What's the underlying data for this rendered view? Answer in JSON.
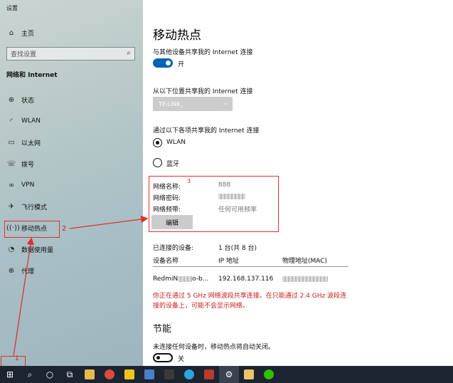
{
  "window": {
    "title": "设置"
  },
  "sidebar": {
    "home": "主页",
    "search_placeholder": "查找设置",
    "section": "网络和 Internet",
    "items": [
      {
        "label": "状态",
        "icon": "globe-icon"
      },
      {
        "label": "WLAN",
        "icon": "wifi-icon"
      },
      {
        "label": "以太网",
        "icon": "ethernet-icon"
      },
      {
        "label": "拨号",
        "icon": "dialup-icon"
      },
      {
        "label": "VPN",
        "icon": "vpn-icon"
      },
      {
        "label": "飞行模式",
        "icon": "airplane-icon"
      },
      {
        "label": "移动热点",
        "icon": "hotspot-icon"
      },
      {
        "label": "数据使用量",
        "icon": "data-usage-icon"
      },
      {
        "label": "代理",
        "icon": "globe-icon"
      }
    ]
  },
  "main": {
    "title": "移动热点",
    "share_label": "与其他设备共享我的 Internet 连接",
    "share_state": "开",
    "share_from_label": "从以下位置共享我的 Internet 连接",
    "share_from_value": "TP-LINK_",
    "share_over_label": "通过以下各项共享我的 Internet 连接",
    "share_over_options": [
      "WLAN",
      "蓝牙"
    ],
    "network": {
      "name_key": "网络名称:",
      "name_value": "888",
      "password_key": "网络密码:",
      "band_key": "网络频带:",
      "band_value": "任何可用频率",
      "edit_button": "编辑"
    },
    "devices": {
      "connected_label": "已连接的设备:",
      "connected_count": "1 台(共 8 台)",
      "headers": [
        "设备名称",
        "IP 地址",
        "物理地址(MAC)"
      ],
      "rows": [
        {
          "name": "RedmiN",
          "name_suffix": "o-b...",
          "ip": "192.168.137.116"
        }
      ]
    },
    "warning": "你正在通过 5 GHz 网络波段共享连接。在只能通过 2.4 GHz 波段连接的设备上，可能不会显示网络。",
    "power_title": "节能",
    "power_desc": "未连接任何设备时，移动热点将自动关闭。",
    "power_state": "关"
  },
  "annotations": {
    "n1": "1",
    "n2": "2",
    "n3": "3"
  },
  "colors": {
    "accent": "#0063b1",
    "warning": "#c81e1e",
    "annotation": "#e03030"
  }
}
